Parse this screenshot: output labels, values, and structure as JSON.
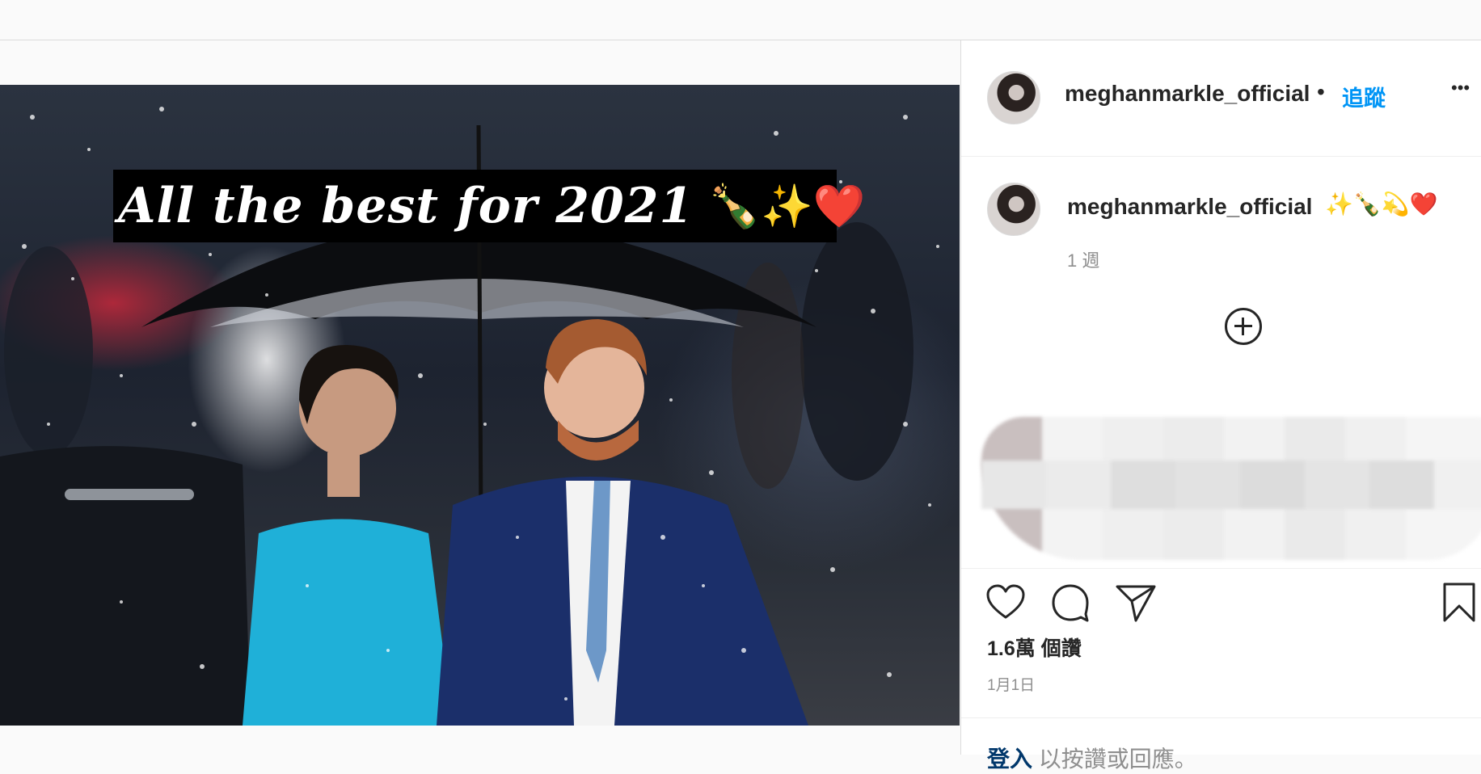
{
  "post": {
    "caption_text": "All the best for 2021",
    "caption_emoji": "🍾✨❤️",
    "photo_alt": "Couple under umbrella in the rain"
  },
  "sidebar": {
    "header": {
      "username": "meghanmarkle_official",
      "separator": "•",
      "follow_label": "追蹤",
      "more_label": "•••"
    },
    "caption": {
      "username": "meghanmarkle_official",
      "emoji": "✨🍾💫❤️",
      "time_ago": "1 週"
    },
    "likes": "1.6萬 個讚",
    "date": "1月1日",
    "login_link": "登入",
    "login_rest": " 以按讚或回應。"
  },
  "icons": {
    "like": "heart-icon",
    "comment": "comment-bubble-icon",
    "share": "paper-plane-icon",
    "save": "bookmark-icon",
    "load_more": "plus-circle-icon"
  }
}
